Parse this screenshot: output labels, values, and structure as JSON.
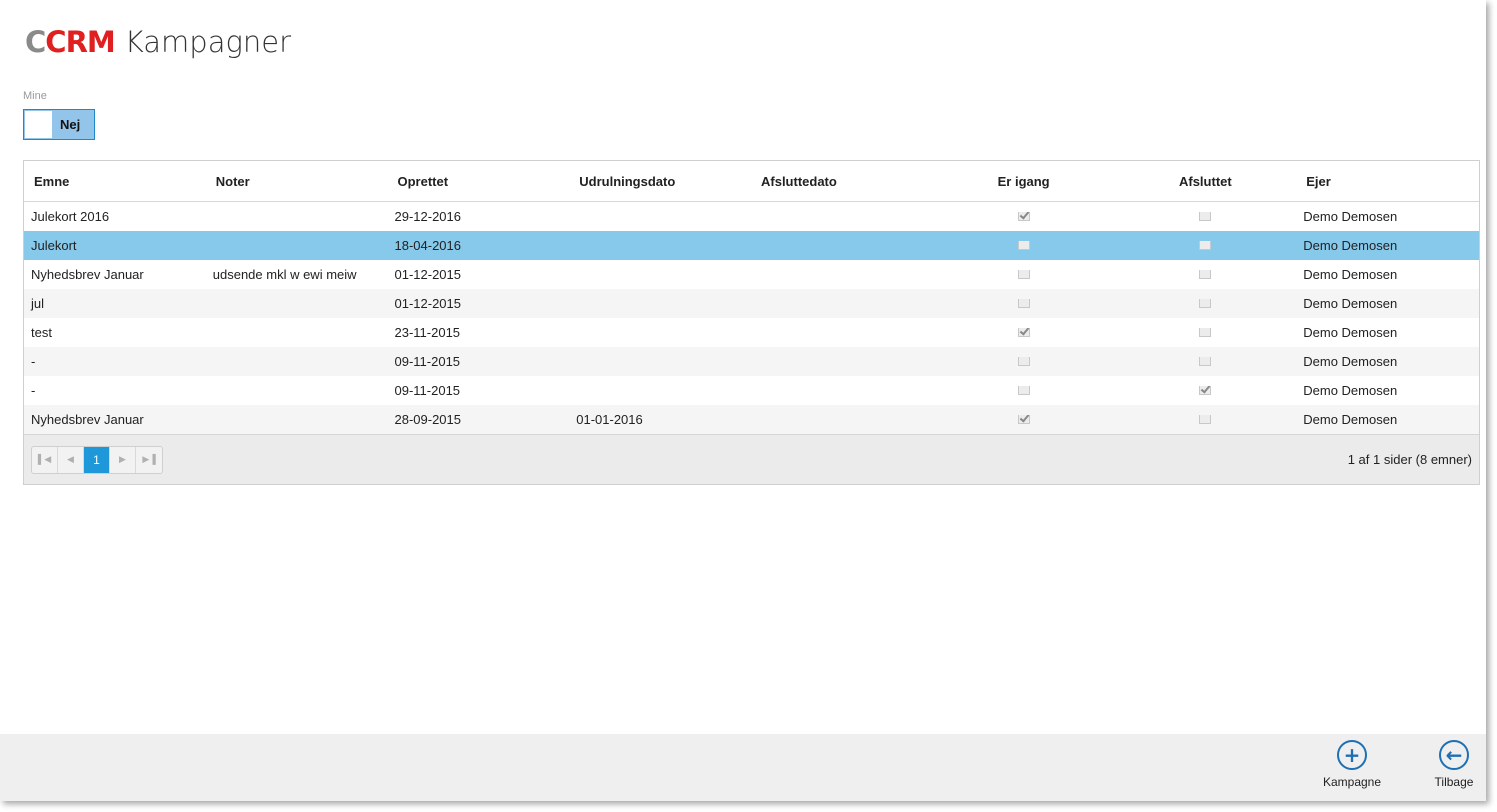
{
  "header": {
    "logo_c": "C",
    "logo_crm": "CRM",
    "title": "Kampagner"
  },
  "filter": {
    "label": "Mine",
    "toggle_value": "Nej"
  },
  "table": {
    "columns": [
      "Emne",
      "Noter",
      "Oprettet",
      "Udrulningsdato",
      "Afsluttedato",
      "Er igang",
      "Afsluttet",
      "Ejer"
    ],
    "rows": [
      {
        "emne": "Julekort 2016",
        "noter": "",
        "oprettet": "29-12-2016",
        "udrulning": "",
        "afslutte": "",
        "er_igang": true,
        "afsluttet": false,
        "ejer": "Demo Demosen"
      },
      {
        "emne": "Julekort",
        "noter": "",
        "oprettet": "18-04-2016",
        "udrulning": "",
        "afslutte": "",
        "er_igang": false,
        "afsluttet": false,
        "ejer": "Demo Demosen",
        "selected": true
      },
      {
        "emne": "Nyhedsbrev Januar",
        "noter": "udsende mkl w ewi meiw",
        "oprettet": "01-12-2015",
        "udrulning": "",
        "afslutte": "",
        "er_igang": false,
        "afsluttet": false,
        "ejer": "Demo Demosen"
      },
      {
        "emne": "jul",
        "noter": "",
        "oprettet": "01-12-2015",
        "udrulning": "",
        "afslutte": "",
        "er_igang": false,
        "afsluttet": false,
        "ejer": "Demo Demosen"
      },
      {
        "emne": "test",
        "noter": "",
        "oprettet": "23-11-2015",
        "udrulning": "",
        "afslutte": "",
        "er_igang": true,
        "afsluttet": false,
        "ejer": "Demo Demosen"
      },
      {
        "emne": "-",
        "noter": "",
        "oprettet": "09-11-2015",
        "udrulning": "",
        "afslutte": "",
        "er_igang": false,
        "afsluttet": false,
        "ejer": "Demo Demosen"
      },
      {
        "emne": "-",
        "noter": "",
        "oprettet": "09-11-2015",
        "udrulning": "",
        "afslutte": "",
        "er_igang": false,
        "afsluttet": true,
        "ejer": "Demo Demosen"
      },
      {
        "emne": "Nyhedsbrev Januar",
        "noter": "",
        "oprettet": "28-09-2015",
        "udrulning": "01-01-2016",
        "afslutte": "",
        "er_igang": true,
        "afsluttet": false,
        "ejer": "Demo Demosen"
      }
    ]
  },
  "pager": {
    "first_icon": "first-page-icon",
    "prev_icon": "prev-page-icon",
    "current_page": "1",
    "next_icon": "next-page-icon",
    "last_icon": "last-page-icon",
    "info": "1 af 1 sider (8 emner)"
  },
  "appbar": {
    "add": {
      "label": "Kampagne",
      "icon": "plus-circle-icon"
    },
    "back": {
      "label": "Tilbage",
      "icon": "arrow-left-circle-icon"
    }
  },
  "colors": {
    "accent": "#1e98d8",
    "selected_row": "#87c9ea",
    "logo_red": "#e02020",
    "toggle_bg": "#93c5ea"
  }
}
